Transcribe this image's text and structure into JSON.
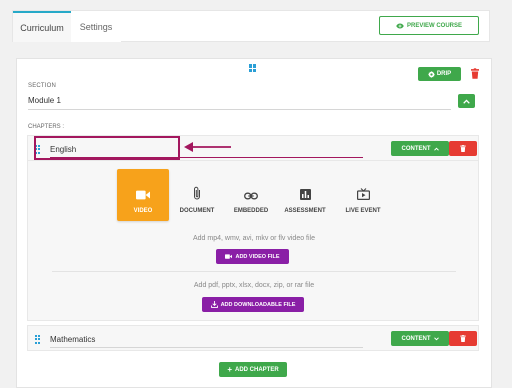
{
  "tabs": [
    {
      "label": "Curriculum",
      "active": true
    },
    {
      "label": "Settings",
      "active": false
    }
  ],
  "preview_button": {
    "label": "PREVIEW COURSE",
    "icon": "eye-icon"
  },
  "section": {
    "label": "SECTION",
    "value": "Module 1",
    "drip_label": "DRIP"
  },
  "chapters_label": "CHAPTERS :",
  "chapters": [
    {
      "name": "English",
      "content_label": "CONTENT",
      "expanded": true
    },
    {
      "name": "Mathematics",
      "content_label": "CONTENT",
      "expanded": false
    }
  ],
  "content_types": [
    {
      "label": "VIDEO",
      "icon": "video-camera-icon",
      "active": true
    },
    {
      "label": "DOCUMENT",
      "icon": "paperclip-icon",
      "active": false
    },
    {
      "label": "EMBEDDED",
      "icon": "link-icon",
      "active": false
    },
    {
      "label": "ASSESSMENT",
      "icon": "bar-chart-icon",
      "active": false
    },
    {
      "label": "LIVE EVENT",
      "icon": "live-tv-icon",
      "active": false
    }
  ],
  "video_upload": {
    "hint": "Add mp4, wmv, avi, mkv or flv video file",
    "button_label": "ADD VIDEO FILE"
  },
  "download_upload": {
    "hint": "Add pdf, pptx, xlsx, docx, zip, or rar file",
    "button_label": "ADD DOWNLOADABLE FILE"
  },
  "add_chapter_label": "ADD CHAPTER",
  "colors": {
    "green": "#3fa84b",
    "red": "#e63b32",
    "orange": "#f7a21b",
    "purple": "#8a1fa6",
    "highlight": "#a3175e",
    "accent": "#26a9c8"
  }
}
